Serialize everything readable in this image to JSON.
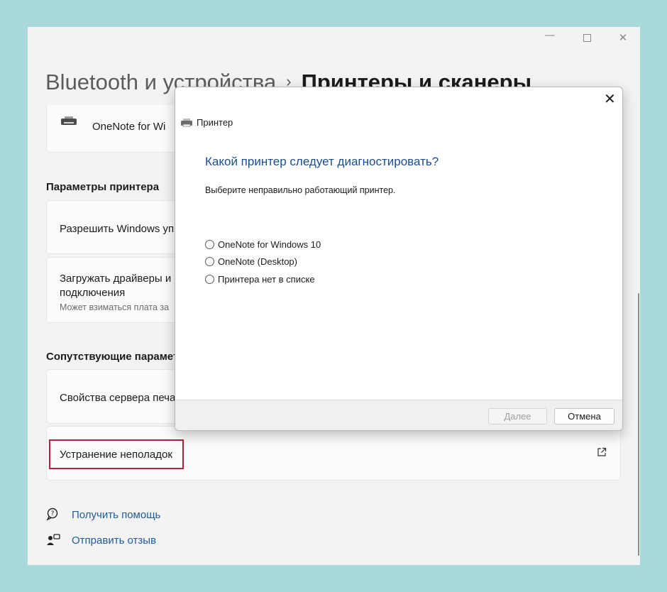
{
  "window": {
    "controls": {
      "minimize": "—",
      "close": "✕"
    }
  },
  "breadcrumb": {
    "parent": "Bluetooth и устройства",
    "separator": "›",
    "current": "Принтеры и сканеры"
  },
  "printer_card": {
    "label": "OneNote for Wi"
  },
  "printer_settings": {
    "section_title": "Параметры принтера",
    "allow_windows": "Разрешить Windows уп",
    "drivers_line1": "Загружать драйверы и",
    "drivers_line2": "подключения",
    "drivers_sub": "Может взиматься плата за"
  },
  "related": {
    "section_title": "Сопутствующие парамет",
    "server_props": "Свойства сервера печа",
    "troubleshoot": "Устранение неполадок"
  },
  "links": {
    "help": "Получить помощь",
    "feedback": "Отправить отзыв"
  },
  "dialog": {
    "close": "✕",
    "title": "Принтер",
    "heading": "Какой принтер следует диагностировать?",
    "instruction": "Выберите неправильно работающий принтер.",
    "options": [
      "OneNote for Windows 10",
      "OneNote (Desktop)",
      "Принтера нет в списке"
    ],
    "next_label": "Далее",
    "cancel_label": "Отмена"
  },
  "colors": {
    "background": "#a9d9db",
    "accent_link": "#1f5a99",
    "highlight": "#b0213d",
    "dialog_heading": "#1a4e8f"
  }
}
